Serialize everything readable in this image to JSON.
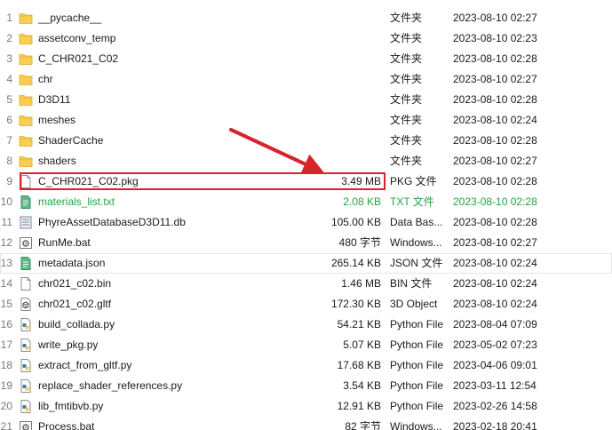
{
  "accent_colors": {
    "annotation_red": "#d8232a",
    "folder_yellow": "#f8cf50",
    "git_green": "#23a442"
  },
  "files": [
    {
      "num": "1",
      "icon": "folder-icon",
      "name": "__pycache__",
      "size": "",
      "type": "文件夹",
      "date": "2023-08-10 02:27"
    },
    {
      "num": "2",
      "icon": "folder-icon",
      "name": "assetconv_temp",
      "size": "",
      "type": "文件夹",
      "date": "2023-08-10 02:23"
    },
    {
      "num": "3",
      "icon": "folder-icon",
      "name": "C_CHR021_C02",
      "size": "",
      "type": "文件夹",
      "date": "2023-08-10 02:28"
    },
    {
      "num": "4",
      "icon": "folder-icon",
      "name": "chr",
      "size": "",
      "type": "文件夹",
      "date": "2023-08-10 02:27"
    },
    {
      "num": "5",
      "icon": "folder-icon",
      "name": "D3D11",
      "size": "",
      "type": "文件夹",
      "date": "2023-08-10 02:28"
    },
    {
      "num": "6",
      "icon": "folder-icon",
      "name": "meshes",
      "size": "",
      "type": "文件夹",
      "date": "2023-08-10 02:24"
    },
    {
      "num": "7",
      "icon": "folder-icon",
      "name": "ShaderCache",
      "size": "",
      "type": "文件夹",
      "date": "2023-08-10 02:28"
    },
    {
      "num": "8",
      "icon": "folder-icon",
      "name": "shaders",
      "size": "",
      "type": "文件夹",
      "date": "2023-08-10 02:27"
    },
    {
      "num": "9",
      "icon": "file-icon",
      "name": "C_CHR021_C02.pkg",
      "size": "3.49 MB",
      "type": "PKG 文件",
      "date": "2023-08-10 02:28"
    },
    {
      "num": "10",
      "icon": "text-file-icon",
      "name": "materials_list.txt",
      "size": "2.08 KB",
      "type": "TXT 文件",
      "date": "2023-08-10 02:28"
    },
    {
      "num": "11",
      "icon": "database-file-icon",
      "name": "PhyreAssetDatabaseD3D11.db",
      "size": "105.00 KB",
      "type": "Data Bas...",
      "date": "2023-08-10 02:28"
    },
    {
      "num": "12",
      "icon": "batch-file-icon",
      "name": "RunMe.bat",
      "size": "480 字节",
      "type": "Windows...",
      "date": "2023-08-10 02:27"
    },
    {
      "num": "13",
      "icon": "json-file-icon",
      "name": "metadata.json",
      "size": "265.14 KB",
      "type": "JSON 文件",
      "date": "2023-08-10 02:24"
    },
    {
      "num": "14",
      "icon": "file-icon",
      "name": "chr021_c02.bin",
      "size": "1.46 MB",
      "type": "BIN 文件",
      "date": "2023-08-10 02:24"
    },
    {
      "num": "15",
      "icon": "3d-object-icon",
      "name": "chr021_c02.gltf",
      "size": "172.30 KB",
      "type": "3D Object",
      "date": "2023-08-10 02:24"
    },
    {
      "num": "16",
      "icon": "python-file-icon",
      "name": "build_collada.py",
      "size": "54.21 KB",
      "type": "Python File",
      "date": "2023-08-04 07:09"
    },
    {
      "num": "17",
      "icon": "python-file-icon",
      "name": "write_pkg.py",
      "size": "5.07 KB",
      "type": "Python File",
      "date": "2023-05-02 07:23"
    },
    {
      "num": "18",
      "icon": "python-file-icon",
      "name": "extract_from_gltf.py",
      "size": "17.68 KB",
      "type": "Python File",
      "date": "2023-04-06 09:01"
    },
    {
      "num": "19",
      "icon": "python-file-icon",
      "name": "replace_shader_references.py",
      "size": "3.54 KB",
      "type": "Python File",
      "date": "2023-03-11 12:54"
    },
    {
      "num": "20",
      "icon": "python-file-icon",
      "name": "lib_fmtibvb.py",
      "size": "12.91 KB",
      "type": "Python File",
      "date": "2023-02-26 14:58"
    },
    {
      "num": "21",
      "icon": "batch-file-icon",
      "name": "Process.bat",
      "size": "82 字节",
      "type": "Windows...",
      "date": "2023-02-18 20:41"
    }
  ]
}
